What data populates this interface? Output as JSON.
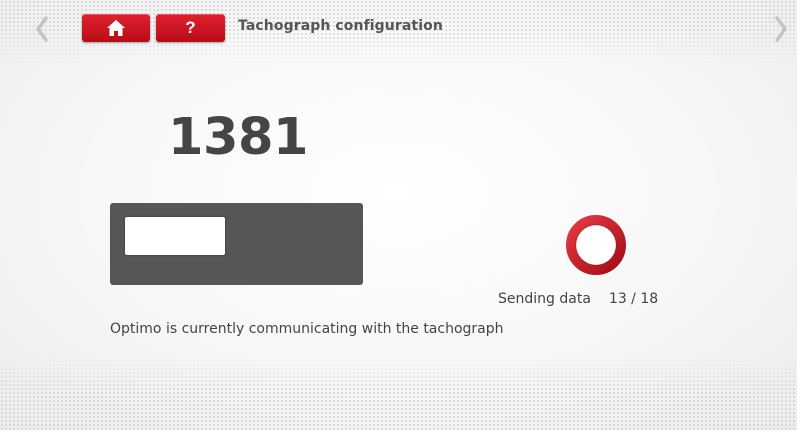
{
  "header": {
    "title": "Tachograph configuration",
    "home_icon": "home-icon",
    "help_label": "?",
    "back_icon": "chevron-left-icon",
    "forward_icon": "chevron-right-icon",
    "button_color": "#d0151f"
  },
  "main": {
    "value": "1381",
    "progress_fraction": 0.45,
    "status_label": "Sending data",
    "status_count": "13 / 18",
    "message": "Optimo is currently communicating with the tachograph",
    "spinner_color": "#c8141e"
  }
}
